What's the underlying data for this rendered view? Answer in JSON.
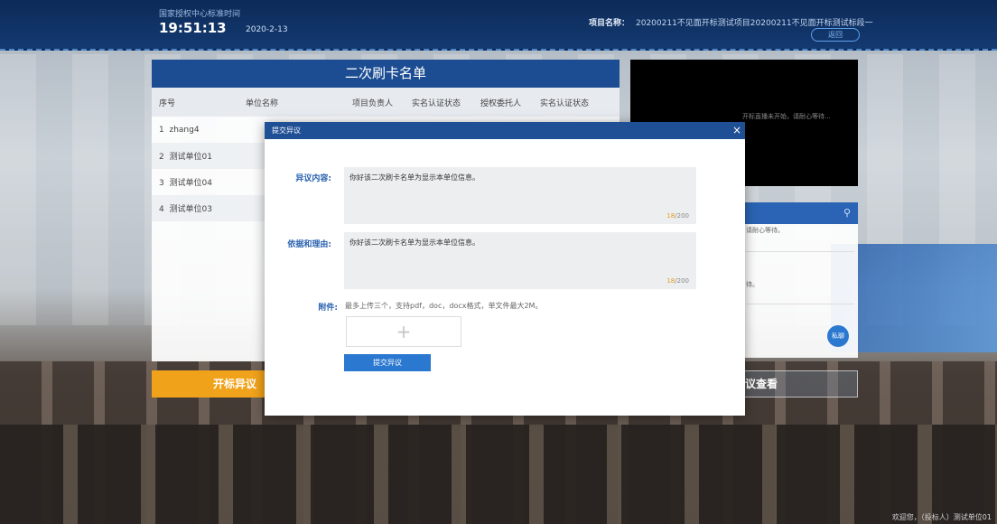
{
  "header": {
    "time_label": "国家授权中心标准时间",
    "time": "19:51:13",
    "date": "2020-2-13",
    "project_label": "项目名称：",
    "project_name": "20200211不见面开标测试项目20200211不见面开标测试标段一",
    "back_label": "返回"
  },
  "list": {
    "title": "二次刷卡名单",
    "columns": [
      "序号",
      "单位名称",
      "项目负责人",
      "实名认证状态",
      "授权委托人",
      "实名认证状态"
    ],
    "rows": [
      {
        "no": "1",
        "name": "zhang4"
      },
      {
        "no": "2",
        "name": "测试单位01"
      },
      {
        "no": "3",
        "name": "测试单位04"
      },
      {
        "no": "4",
        "name": "测试单位03"
      }
    ]
  },
  "actions": {
    "objection": "开标异议",
    "view": "议查看"
  },
  "video": {
    "message": "开标直播未开始，请耐心等待..."
  },
  "chat": {
    "msg1": "请耐心等待。",
    "msg2": "待。",
    "private": "私聊"
  },
  "modal": {
    "title": "提交异议",
    "close": "×",
    "content_label": "异议内容:",
    "content_text": "你好该二次刷卡名单为显示本单位信息。",
    "content_count": "18",
    "content_max": "/200",
    "reason_label": "依据和理由:",
    "reason_text": "你好该二次刷卡名单为显示本单位信息。",
    "reason_count": "18",
    "reason_max": "/200",
    "attach_label": "附件:",
    "attach_hint": "最多上传三个，支持pdf，doc，docx格式，单文件最大2M。",
    "upload_plus": "+",
    "submit": "提交异议"
  },
  "footer": {
    "welcome": "欢迎您，（投标人）测试单位01"
  },
  "colors": {
    "header_bg": "#0c2a57",
    "panel_title": "#1c4d93",
    "accent": "#2b78d0",
    "orange": "#f0a21a"
  }
}
